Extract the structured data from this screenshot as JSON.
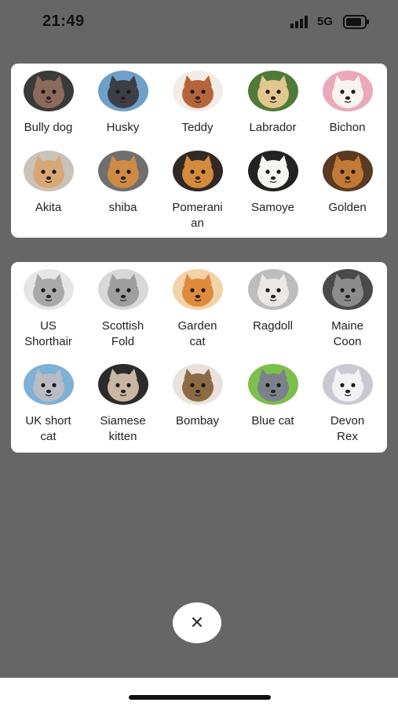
{
  "status_bar": {
    "time": "21:49",
    "network": "5G",
    "icons": [
      "signal-icon",
      "battery-icon"
    ]
  },
  "dogs": [
    {
      "label": "Bully dog",
      "icon": "bully-dog-photo",
      "fur": "#8c6a5c",
      "bg": "#3a3a3a"
    },
    {
      "label": "Husky",
      "icon": "husky-photo",
      "fur": "#3c3f47",
      "bg": "#6fa0c8"
    },
    {
      "label": "Teddy",
      "icon": "teddy-photo",
      "fur": "#b5653a",
      "bg": "#f3ece6"
    },
    {
      "label": "Labrador",
      "icon": "labrador-photo",
      "fur": "#e3c58e",
      "bg": "#4f7b3a"
    },
    {
      "label": "Bichon",
      "icon": "bichon-photo",
      "fur": "#f7f3ee",
      "bg": "#e9a9b9"
    },
    {
      "label": "Akita",
      "icon": "akita-photo",
      "fur": "#d9a776",
      "bg": "#c9c2b8"
    },
    {
      "label": "shiba",
      "icon": "shiba-photo",
      "fur": "#cf8a45",
      "bg": "#6f6f6f"
    },
    {
      "label": "Pomerani\nan",
      "icon": "pomeranian-photo",
      "fur": "#d38b3c",
      "bg": "#2f2a26"
    },
    {
      "label": "Samoye",
      "icon": "samoyed-photo",
      "fur": "#f4f4f2",
      "bg": "#222222"
    },
    {
      "label": "Golden",
      "icon": "golden-retriever-photo",
      "fur": "#c17a35",
      "bg": "#5a3a22"
    }
  ],
  "cats": [
    {
      "label": "US\nShorthair",
      "icon": "us-shorthair-photo",
      "fur": "#a9a9a9",
      "bg": "#e6e6e6"
    },
    {
      "label": "Scottish\nFold",
      "icon": "scottish-fold-photo",
      "fur": "#9e9e9e",
      "bg": "#d8d8d8"
    },
    {
      "label": "Garden\ncat",
      "icon": "garden-cat-photo",
      "fur": "#e08a3c",
      "bg": "#f2d2a8"
    },
    {
      "label": "Ragdoll",
      "icon": "ragdoll-photo",
      "fur": "#ece8e2",
      "bg": "#bdbdbd"
    },
    {
      "label": "Maine\nCoon",
      "icon": "maine-coon-photo",
      "fur": "#8c8c8c",
      "bg": "#4a4a4a"
    },
    {
      "label": "UK short\ncat",
      "icon": "uk-shorthair-photo",
      "fur": "#b9bcc4",
      "bg": "#7fb0d6"
    },
    {
      "label": "Siamese\nkitten",
      "icon": "siamese-kitten-photo",
      "fur": "#c9b7a3",
      "bg": "#2b2b2b"
    },
    {
      "label": "Bombay",
      "icon": "bombay-photo",
      "fur": "#8b6a45",
      "bg": "#e8e2da"
    },
    {
      "label": "Blue cat",
      "icon": "blue-cat-photo",
      "fur": "#7c828c",
      "bg": "#7cbf4a"
    },
    {
      "label": "Devon\nRex",
      "icon": "devon-rex-photo",
      "fur": "#f2f2f4",
      "bg": "#c9c9d1"
    }
  ],
  "close_button": {
    "icon": "close-icon",
    "label": "✕"
  }
}
